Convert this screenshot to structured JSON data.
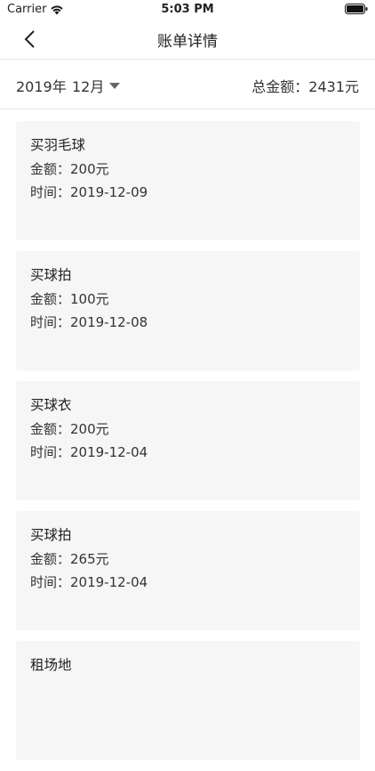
{
  "status_bar": {
    "carrier": "Carrier",
    "time": "5:03 PM",
    "icons": [
      "wifi-icon",
      "battery-icon"
    ]
  },
  "nav": {
    "title": "账单详情",
    "back_icon": "chevron-left-icon"
  },
  "filter": {
    "year": "2019年",
    "month": "12月",
    "total": "总金额：2431元"
  },
  "bills": [
    {
      "name": "买羽毛球",
      "amount": "金额：200元",
      "time": "时间：2019-12-09"
    },
    {
      "name": "买球拍",
      "amount": "金额：100元",
      "time": "时间：2019-12-08"
    },
    {
      "name": "买球衣",
      "amount": "金额：200元",
      "time": "时间：2019-12-04"
    },
    {
      "name": "买球拍",
      "amount": "金额：265元",
      "time": "时间：2019-12-04"
    },
    {
      "name": "租场地",
      "amount": "",
      "time": ""
    }
  ]
}
